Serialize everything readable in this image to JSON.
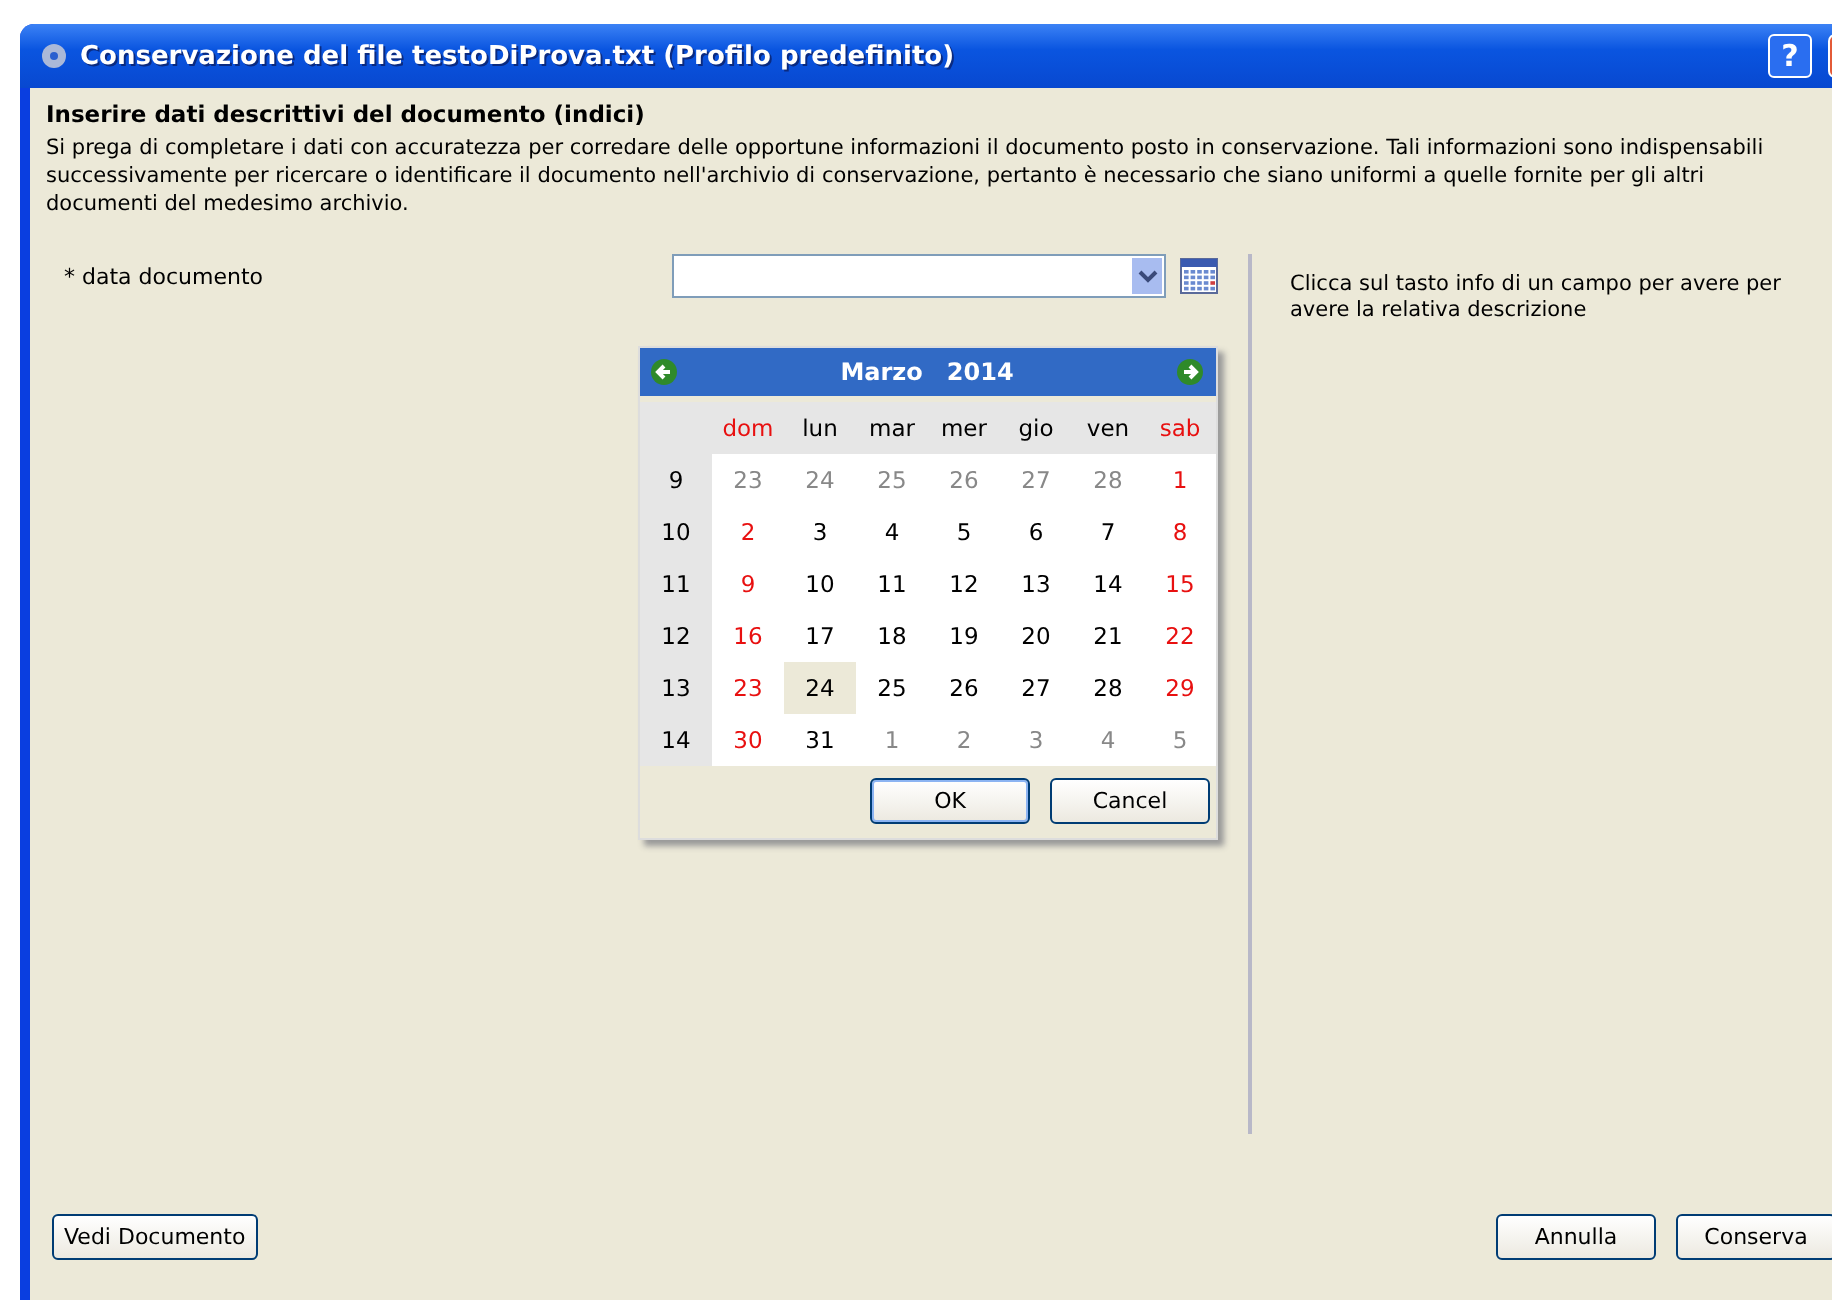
{
  "window": {
    "title": "Conservazione del file testoDiProva.txt (Profilo predefinito)",
    "help_button": "?"
  },
  "heading": "Inserire dati descrittivi del documento (indici)",
  "description": "Si prega di completare i dati con accuratezza per corredare delle opportune informazioni il documento posto in conservazione. Tali informazioni sono indispensabili successivamente per ricercare o identificare il documento nell'archivio di conservazione, pertanto è necessario che siano uniformi a quelle fornite per gli altri documenti del medesimo archivio.",
  "fields": [
    {
      "label": "* data documento",
      "expanded": true
    }
  ],
  "calendar": {
    "month": "Marzo",
    "year": "2014",
    "weekdays": [
      {
        "label": "dom",
        "kind": "weekend"
      },
      {
        "label": "lun",
        "kind": "normal"
      },
      {
        "label": "mar",
        "kind": "normal"
      },
      {
        "label": "mer",
        "kind": "normal"
      },
      {
        "label": "gio",
        "kind": "normal"
      },
      {
        "label": "ven",
        "kind": "normal"
      },
      {
        "label": "sab",
        "kind": "weekend"
      }
    ],
    "weeks": [
      {
        "number": "9",
        "days": [
          {
            "label": "23",
            "kind": "other",
            "selected": false
          },
          {
            "label": "24",
            "kind": "other",
            "selected": false
          },
          {
            "label": "25",
            "kind": "other",
            "selected": false
          },
          {
            "label": "26",
            "kind": "other",
            "selected": false
          },
          {
            "label": "27",
            "kind": "other",
            "selected": false
          },
          {
            "label": "28",
            "kind": "other",
            "selected": false
          },
          {
            "label": "1",
            "kind": "weekend",
            "selected": false
          }
        ]
      },
      {
        "number": "10",
        "days": [
          {
            "label": "2",
            "kind": "weekend",
            "selected": false
          },
          {
            "label": "3",
            "kind": "normal",
            "selected": false
          },
          {
            "label": "4",
            "kind": "normal",
            "selected": false
          },
          {
            "label": "5",
            "kind": "normal",
            "selected": false
          },
          {
            "label": "6",
            "kind": "normal",
            "selected": false
          },
          {
            "label": "7",
            "kind": "normal",
            "selected": false
          },
          {
            "label": "8",
            "kind": "weekend",
            "selected": false
          }
        ]
      },
      {
        "number": "11",
        "days": [
          {
            "label": "9",
            "kind": "weekend",
            "selected": false
          },
          {
            "label": "10",
            "kind": "normal",
            "selected": false
          },
          {
            "label": "11",
            "kind": "normal",
            "selected": false
          },
          {
            "label": "12",
            "kind": "normal",
            "selected": false
          },
          {
            "label": "13",
            "kind": "normal",
            "selected": false
          },
          {
            "label": "14",
            "kind": "normal",
            "selected": false
          },
          {
            "label": "15",
            "kind": "weekend",
            "selected": false
          }
        ]
      },
      {
        "number": "12",
        "days": [
          {
            "label": "16",
            "kind": "weekend",
            "selected": false
          },
          {
            "label": "17",
            "kind": "normal",
            "selected": false
          },
          {
            "label": "18",
            "kind": "normal",
            "selected": false
          },
          {
            "label": "19",
            "kind": "normal",
            "selected": false
          },
          {
            "label": "20",
            "kind": "normal",
            "selected": false
          },
          {
            "label": "21",
            "kind": "normal",
            "selected": false
          },
          {
            "label": "22",
            "kind": "weekend",
            "selected": false
          }
        ]
      },
      {
        "number": "13",
        "days": [
          {
            "label": "23",
            "kind": "weekend",
            "selected": false
          },
          {
            "label": "24",
            "kind": "normal",
            "selected": true
          },
          {
            "label": "25",
            "kind": "normal",
            "selected": false
          },
          {
            "label": "26",
            "kind": "normal",
            "selected": false
          },
          {
            "label": "27",
            "kind": "normal",
            "selected": false
          },
          {
            "label": "28",
            "kind": "normal",
            "selected": false
          },
          {
            "label": "29",
            "kind": "weekend",
            "selected": false
          }
        ]
      },
      {
        "number": "14",
        "days": [
          {
            "label": "30",
            "kind": "weekend",
            "selected": false
          },
          {
            "label": "31",
            "kind": "normal",
            "selected": false
          },
          {
            "label": "1",
            "kind": "other",
            "selected": false
          },
          {
            "label": "2",
            "kind": "other",
            "selected": false
          },
          {
            "label": "3",
            "kind": "other",
            "selected": false
          },
          {
            "label": "4",
            "kind": "other",
            "selected": false
          },
          {
            "label": "5",
            "kind": "other",
            "selected": false
          }
        ]
      }
    ],
    "buttons": [
      "OK",
      "Cancel"
    ]
  },
  "info_text": "Clicca sul tasto info di un campo per avere per avere la relativa descrizione",
  "footer": {
    "left_button": "Vedi Documento",
    "right_buttons": [
      "Annulla",
      "Conserva"
    ]
  }
}
